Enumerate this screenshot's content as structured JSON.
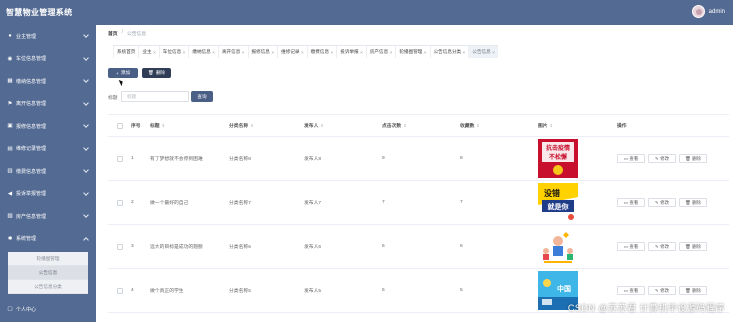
{
  "app": {
    "title": "智慧物业管理系统",
    "username": "admin"
  },
  "sidebar": {
    "items": [
      {
        "label": "业主管理",
        "icon": "user-icon"
      },
      {
        "label": "车位信息管理",
        "icon": "location-icon"
      },
      {
        "label": "缴纳信息管理",
        "icon": "grid-icon"
      },
      {
        "label": "离开信息管理",
        "icon": "flag-icon"
      },
      {
        "label": "报修信息管理",
        "icon": "wrench-icon"
      },
      {
        "label": "维修记录管理",
        "icon": "tool-icon"
      },
      {
        "label": "缴费信息管理",
        "icon": "card-icon"
      },
      {
        "label": "投诉举报管理",
        "icon": "megaphone-icon"
      },
      {
        "label": "房产信息管理",
        "icon": "building-icon"
      },
      {
        "label": "系统管理",
        "icon": "gear-icon"
      }
    ],
    "submenu": [
      {
        "label": "轮播图管理"
      },
      {
        "label": "公告信息"
      },
      {
        "label": "公告信息分类"
      }
    ],
    "last_item": {
      "label": "个人中心",
      "icon": "person-icon"
    }
  },
  "breadcrumb": {
    "home": "首页",
    "separator": "/",
    "current": "公告信息"
  },
  "tabs": [
    {
      "label": "系统首页",
      "closable": false
    },
    {
      "label": "业主",
      "closable": true
    },
    {
      "label": "车位信息",
      "closable": true
    },
    {
      "label": "缴纳信息",
      "closable": true
    },
    {
      "label": "离开信息",
      "closable": true
    },
    {
      "label": "报修信息",
      "closable": true
    },
    {
      "label": "维修记录",
      "closable": true
    },
    {
      "label": "缴费信息",
      "closable": true
    },
    {
      "label": "投诉举报",
      "closable": true
    },
    {
      "label": "房产信息",
      "closable": true
    },
    {
      "label": "轮播图管理",
      "closable": true
    },
    {
      "label": "公告信息分类",
      "closable": true
    },
    {
      "label": "公告信息",
      "closable": true,
      "active": true
    }
  ],
  "toolbar": {
    "add_label": "添加",
    "delete_label": "删除"
  },
  "search": {
    "label": "标题",
    "placeholder": "标题",
    "button_label": "查询"
  },
  "table": {
    "headers": {
      "no": "序号",
      "title": "标题",
      "category": "分类名称",
      "publisher": "发布人",
      "clicks": "点击次数",
      "favorites": "收藏数",
      "image": "图片",
      "ops": "操作"
    },
    "rows": [
      {
        "no": "1",
        "title": "有了梦想就不会停到困难",
        "category": "分类名称8",
        "publisher": "发布人8",
        "clicks": "9",
        "favorites": "8",
        "image": "poster-red",
        "image_text_1": "抗击疫情",
        "image_text_2": "不松懈"
      },
      {
        "no": "2",
        "title": "做一个最好的自己",
        "category": "分类名称7",
        "publisher": "发布人7",
        "clicks": "7",
        "favorites": "7",
        "image": "poster-cheer",
        "image_text_1": "没错",
        "image_text_2": "就是你"
      },
      {
        "no": "3",
        "title": "远大的目标是成功的翅膀",
        "category": "分类名称6",
        "publisher": "发布人6",
        "clicks": "6",
        "favorites": "6",
        "image": "illustration-people",
        "image_text_1": "",
        "image_text_2": ""
      },
      {
        "no": "4",
        "title": "做个真正的学生",
        "category": "分类名称5",
        "publisher": "发布人5",
        "clicks": "5",
        "favorites": "5",
        "image": "poster-china",
        "image_text_1": "中国",
        "image_text_2": ""
      }
    ],
    "ops": {
      "view": "查看",
      "edit": "修改",
      "delete": "删除"
    }
  },
  "watermark": "CSDN @苏苏君  计算机毕设源码程序",
  "colors": {
    "sidebar": "#536a92",
    "primary_button": "#4a5f86",
    "danger_button": "#2f3d57"
  }
}
